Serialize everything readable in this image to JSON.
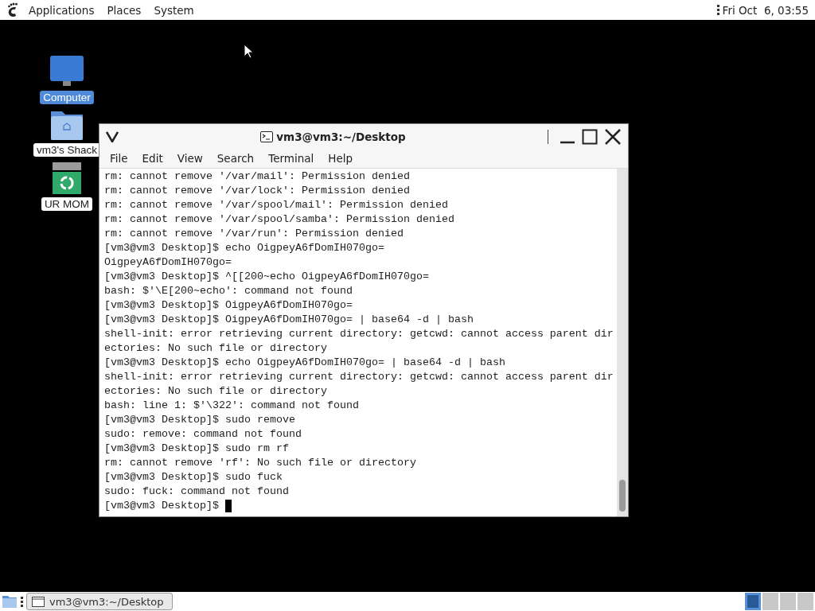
{
  "top_panel": {
    "menus": [
      "Applications",
      "Places",
      "System"
    ],
    "clock": "Fri Oct  6, 03:55"
  },
  "desktop_icons": [
    {
      "kind": "computer",
      "label": "Computer",
      "selected": true
    },
    {
      "kind": "folder",
      "label": "vm3's Shack",
      "selected": false
    },
    {
      "kind": "trash",
      "label": "UR MOM",
      "selected": false
    }
  ],
  "terminal": {
    "title": "vm3@vm3:~/Desktop",
    "menus": [
      "File",
      "Edit",
      "View",
      "Search",
      "Terminal",
      "Help"
    ],
    "lines": [
      "rm: cannot remove '/var/mail': Permission denied",
      "rm: cannot remove '/var/lock': Permission denied",
      "rm: cannot remove '/var/spool/mail': Permission denied",
      "rm: cannot remove '/var/spool/samba': Permission denied",
      "rm: cannot remove '/var/run': Permission denied",
      "[vm3@vm3 Desktop]$ echo OigpeyA6fDomIH070go=",
      "OigpeyA6fDomIH070go=",
      "[vm3@vm3 Desktop]$ ^[[200~echo OigpeyA6fDomIH070go=",
      "bash: $'\\E[200~echo': command not found",
      "[vm3@vm3 Desktop]$ OigpeyA6fDomIH070go=",
      "[vm3@vm3 Desktop]$ OigpeyA6fDomIH070go= | base64 -d | bash",
      "shell-init: error retrieving current directory: getcwd: cannot access parent dir",
      "ectories: No such file or directory",
      "[vm3@vm3 Desktop]$ echo OigpeyA6fDomIH070go= | base64 -d | bash",
      "shell-init: error retrieving current directory: getcwd: cannot access parent dir",
      "ectories: No such file or directory",
      "bash: line 1: $'\\322': command not found",
      "[vm3@vm3 Desktop]$ sudo remove",
      "sudo: remove: command not found",
      "[vm3@vm3 Desktop]$ sudo rm rf",
      "rm: cannot remove 'rf': No such file or directory",
      "[vm3@vm3 Desktop]$ sudo fuck",
      "sudo: fuck: command not found"
    ],
    "prompt": "[vm3@vm3 Desktop]$"
  },
  "taskbar": {
    "windows": [
      {
        "label": "vm3@vm3:~/Desktop"
      }
    ],
    "workspaces": [
      {
        "selected": true
      },
      {
        "selected": false
      },
      {
        "selected": false
      },
      {
        "selected": false
      }
    ]
  }
}
